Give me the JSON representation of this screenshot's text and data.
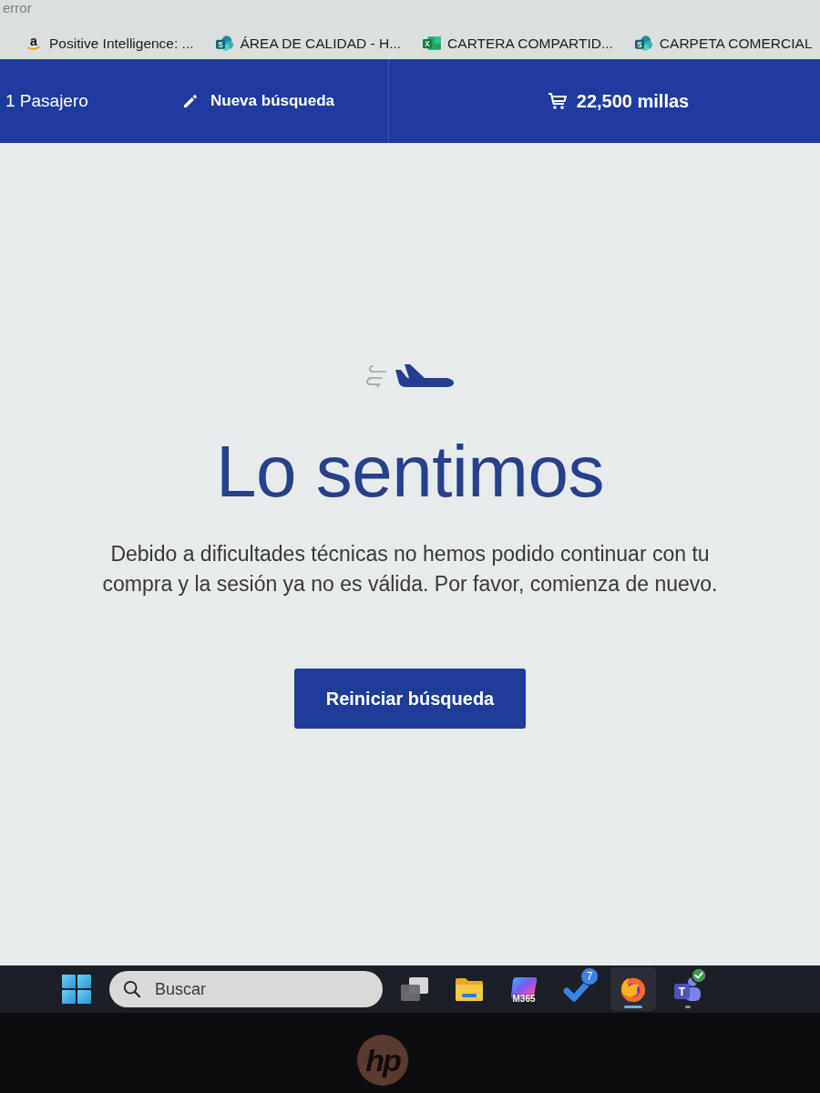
{
  "browser": {
    "tab_title": "error",
    "bookmarks": [
      {
        "kind": "smile",
        "icon_text": "a",
        "label": "Positive Intelligence: ..."
      },
      {
        "kind": "site",
        "icon_text": "S",
        "label": "ÁREA DE CALIDAD - H..."
      },
      {
        "kind": "sheet",
        "icon_text": "X",
        "label": "CARTERA COMPARTID..."
      },
      {
        "kind": "site",
        "icon_text": "S",
        "label": "CARPETA COMERCIAL"
      }
    ]
  },
  "header": {
    "passengers": "1 Pasajero",
    "new_search": "Nueva búsqueda",
    "cart": "22,500 millas"
  },
  "error_page": {
    "title": "Lo sentimos",
    "message": "Debido a dificultades técnicas no hemos podido continuar con tu compra y la sesión ya no es válida. Por favor, comienza de nuevo.",
    "button": "Reiniciar búsqueda"
  },
  "taskbar": {
    "search": {
      "placeholder": "Buscar"
    },
    "apps": [
      {
        "kind": "taskview",
        "running": false,
        "selected": false
      },
      {
        "kind": "folder",
        "running": false,
        "selected": false
      },
      {
        "kind": "tile",
        "icon_text": "M365",
        "running": false,
        "selected": false
      },
      {
        "kind": "check",
        "badge": "7",
        "running": false,
        "selected": false
      },
      {
        "kind": "browser",
        "running": true,
        "selected": true
      },
      {
        "kind": "chat",
        "icon_text": "T",
        "running": true,
        "selected": false
      }
    ]
  },
  "bezel": {
    "logo": "hp"
  }
}
